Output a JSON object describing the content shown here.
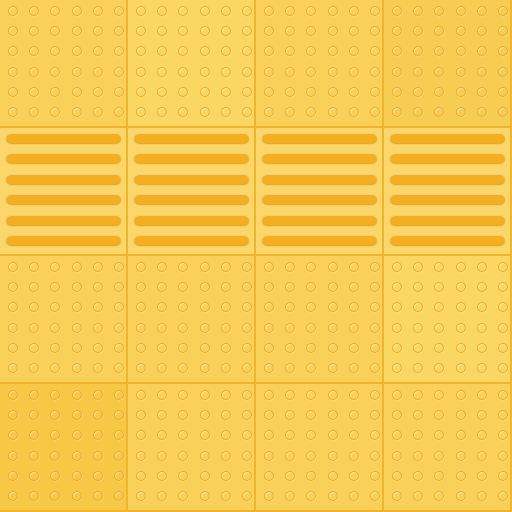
{
  "pattern": {
    "rows": [
      [
        "dots",
        "dots",
        "dots",
        "dots"
      ],
      [
        "bars",
        "bars",
        "bars",
        "bars"
      ],
      [
        "dots",
        "dots",
        "dots",
        "dots"
      ],
      [
        "dots",
        "dots",
        "dots",
        "dots"
      ]
    ],
    "dots_per_side": 6,
    "bars_per_tile": 6
  },
  "colors": {
    "grout": "#f0b52a",
    "dot_tile": "#f9d15a",
    "bar_tile": "#fbd66a",
    "bar": "#f3ae22",
    "dot_outline": "#e8ab2c"
  }
}
